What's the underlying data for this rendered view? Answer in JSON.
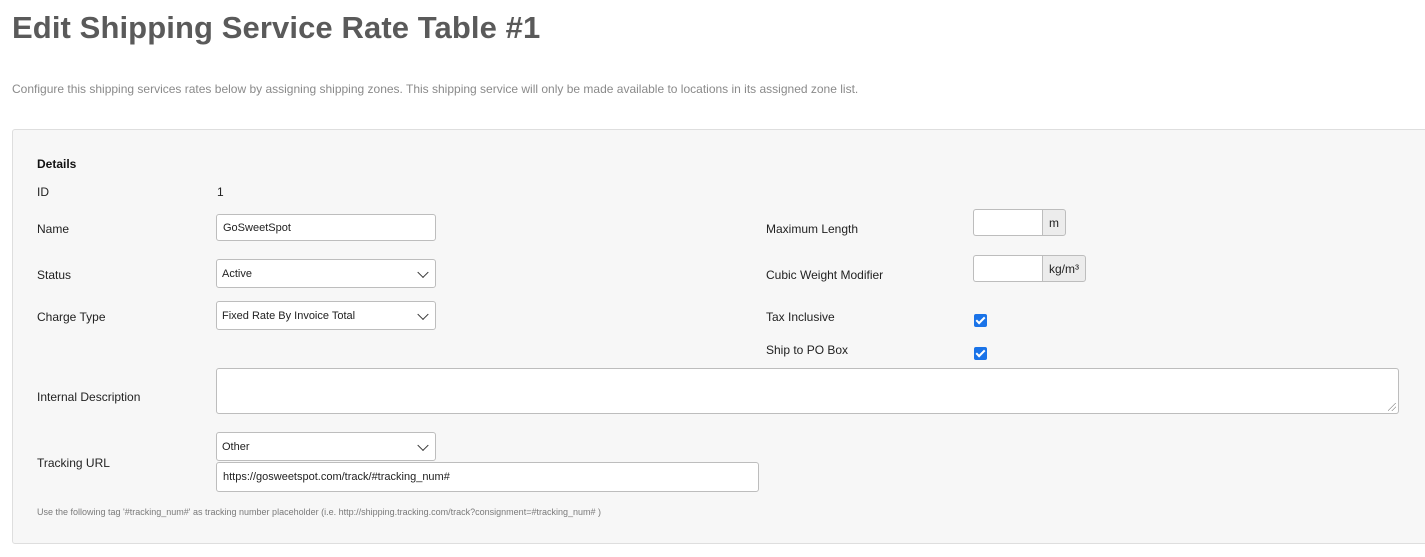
{
  "page": {
    "title": "Edit Shipping Service Rate Table #1",
    "description": "Configure this shipping services rates below by assigning shipping zones. This shipping service will only be made available to locations in its assigned zone list."
  },
  "details": {
    "section_title": "Details",
    "id_label": "ID",
    "id_value": "1",
    "name_label": "Name",
    "name_value": "GoSweetSpot",
    "status_label": "Status",
    "status_value": "Active",
    "charge_type_label": "Charge Type",
    "charge_type_value": "Fixed Rate By Invoice Total",
    "max_length_label": "Maximum Length",
    "max_length_value": "",
    "max_length_unit": "m",
    "cubic_label": "Cubic Weight Modifier",
    "cubic_value": "",
    "cubic_unit": "kg/m³",
    "tax_inclusive_label": "Tax Inclusive",
    "tax_inclusive_checked": true,
    "po_box_label": "Ship to PO Box",
    "po_box_checked": true,
    "internal_desc_label": "Internal Description",
    "internal_desc_value": "",
    "tracking_label": "Tracking URL",
    "tracking_select_value": "Other",
    "tracking_url_value": "https://gosweetspot.com/track/#tracking_num#",
    "tracking_help": "Use the following tag '#tracking_num#' as tracking number placeholder (i.e. http://shipping.tracking.com/track?consignment=#tracking_num# )"
  },
  "colors": {
    "checkbox": "#1a73e8",
    "title": "#5a5a5a",
    "panel_bg": "#f7f7f7"
  }
}
